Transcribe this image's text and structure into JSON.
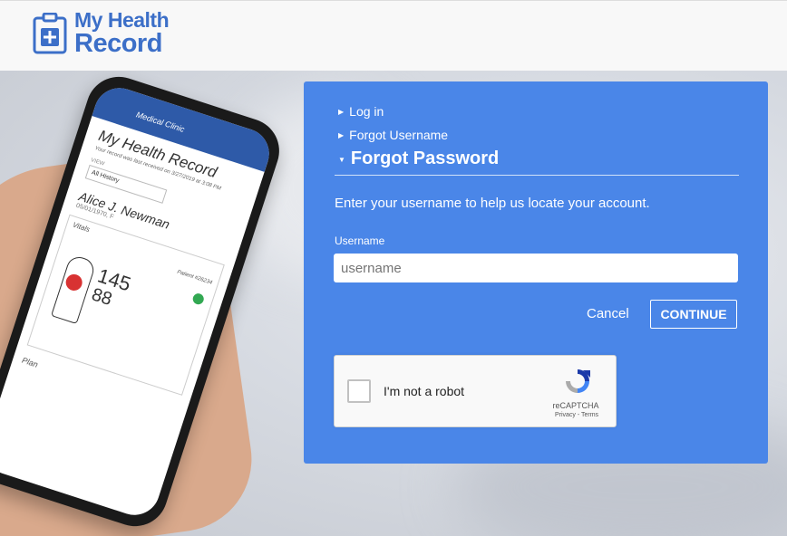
{
  "brand": {
    "line1": "My Health",
    "line2": "Record",
    "color": "#3c6fc8"
  },
  "phone_screen": {
    "header": "Medical Clinic",
    "title": "My Health Record",
    "subtitle": "Your record was last received on 3/27/2019 at 3:08 PM",
    "view_label": "VIEW",
    "view_value": "All History",
    "patient_name": "Alice J. Newman",
    "patient_dob": "05/01/1970, F",
    "vitals_title": "Vitals",
    "patient_id": "Patient #26234",
    "bp_top": "145",
    "bp_bottom": "88",
    "plan_label": "Plan"
  },
  "form": {
    "nav": {
      "login": "Log in",
      "forgot_username": "Forgot Username",
      "forgot_password": "Forgot Password"
    },
    "instructions": "Enter your username to help us locate your account.",
    "username_label": "Username",
    "username_placeholder": "username",
    "cancel_label": "Cancel",
    "continue_label": "CONTINUE",
    "panel_color": "#4a86e8"
  },
  "recaptcha": {
    "label": "I'm not a robot",
    "brand": "reCAPTCHA",
    "links": "Privacy - Terms"
  }
}
